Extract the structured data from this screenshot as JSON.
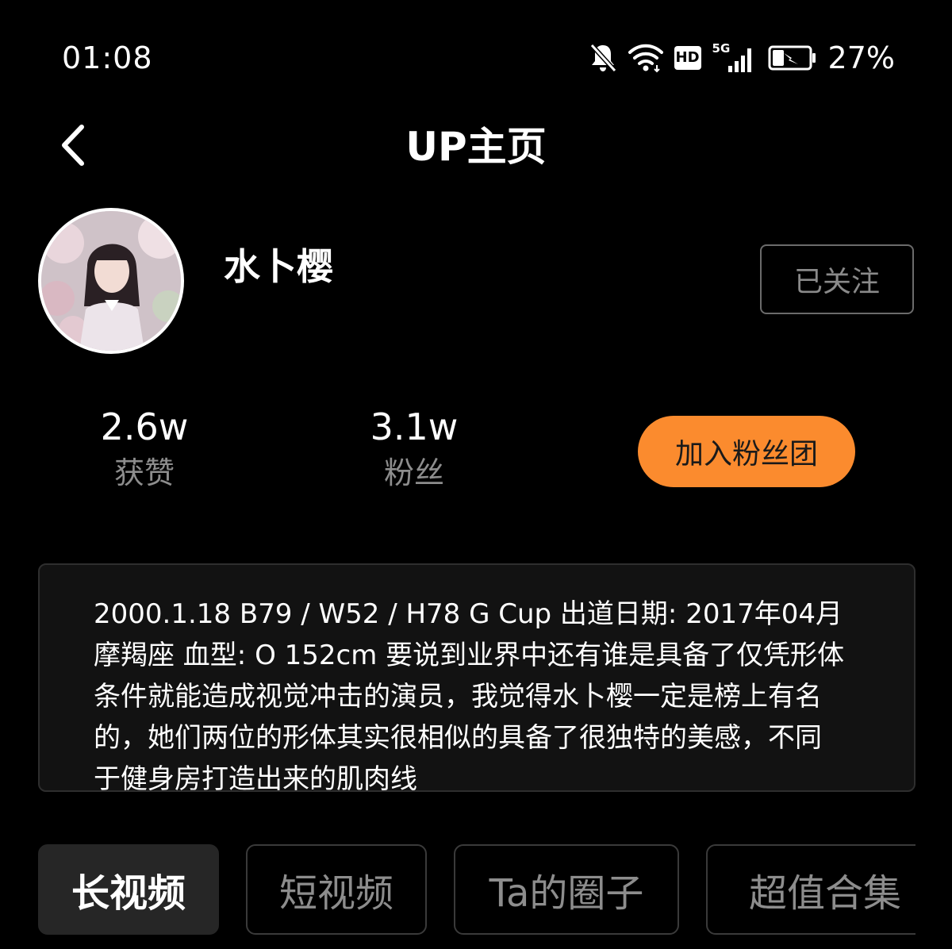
{
  "status_bar": {
    "time": "01:08",
    "icons": [
      "bell-off-icon",
      "wifi-icon",
      "hd-icon",
      "5g-signal-icon",
      "battery-charging-icon"
    ],
    "hd_label": "HD",
    "network_label": "5G",
    "battery_percent": "27%"
  },
  "header": {
    "title": "UP主页",
    "back_icon": "chevron-left-icon"
  },
  "profile": {
    "name": "水卜樱",
    "follow_label": "已关注"
  },
  "stats": {
    "likes_value": "2.6w",
    "likes_label": "获赞",
    "fans_value": "3.1w",
    "fans_label": "粉丝",
    "fan_club_label": "加入粉丝团"
  },
  "bio": {
    "text": "2000.1.18 B79 / W52 / H78 G Cup 出道日期: 2017年04月 摩羯座 血型: O 152cm 要说到业界中还有谁是具备了仅凭形体条件就能造成视觉冲击的演员，我觉得水卜樱一定是榜上有名的，她们两位的形体其实很相似的具备了很独特的美感，不同于健身房打造出来的肌肉线"
  },
  "tabs": [
    {
      "label": "长视频",
      "active": true
    },
    {
      "label": "短视频",
      "active": false
    },
    {
      "label": "Ta的圈子",
      "active": false
    },
    {
      "label": "超值合集",
      "active": false
    }
  ],
  "colors": {
    "background": "#000000",
    "accent_orange": "#fb8b2e",
    "muted_text": "#8d8d8d",
    "bio_background": "#121212"
  }
}
